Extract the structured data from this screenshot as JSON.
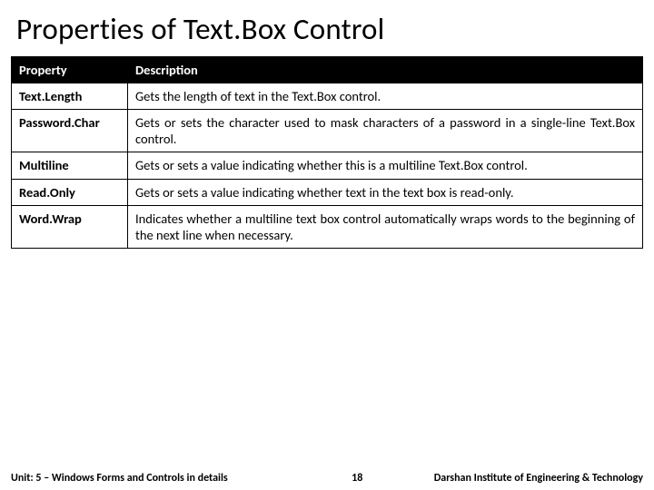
{
  "title": "Properties of Text.Box Control",
  "table": {
    "headers": {
      "property": "Property",
      "description": "Description"
    },
    "rows": [
      {
        "property": "Text.Length",
        "description": "Gets the length of text in the Text.Box control."
      },
      {
        "property": "Password.Char",
        "description": "Gets or sets the character used to mask characters of a password in a single-line Text.Box control."
      },
      {
        "property": "Multiline",
        "description": "Gets or sets a value indicating whether this is a multiline Text.Box control."
      },
      {
        "property": "Read.Only",
        "description": "Gets or sets a value indicating whether text in the text box is read-only."
      },
      {
        "property": "Word.Wrap",
        "description": "Indicates whether a multiline text box control automatically wraps words to the beginning of the next line when necessary."
      }
    ]
  },
  "footer": {
    "unit": "Unit: 5 – Windows Forms and Controls in details",
    "page": "18",
    "org": "Darshan Institute of Engineering & Technology"
  }
}
